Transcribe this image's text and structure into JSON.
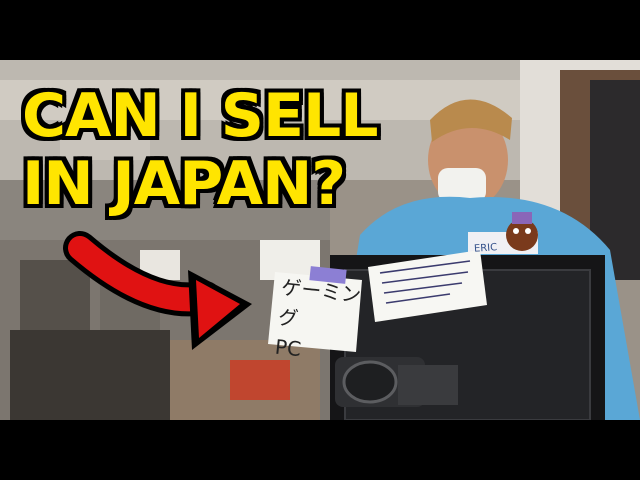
{
  "headline": {
    "line1": "CAN I SELL",
    "line2": "IN JAPAN?"
  },
  "sign": {
    "line1": "ゲーミング",
    "line2": "PC"
  },
  "badge": {
    "name": "ERIC"
  },
  "colors": {
    "headline_fill": "#ffe500",
    "headline_outline": "#000000",
    "arrow": "#e01212",
    "shirt": "#5aa7d6"
  },
  "icons": {
    "arrow": "arrow-right-icon"
  }
}
